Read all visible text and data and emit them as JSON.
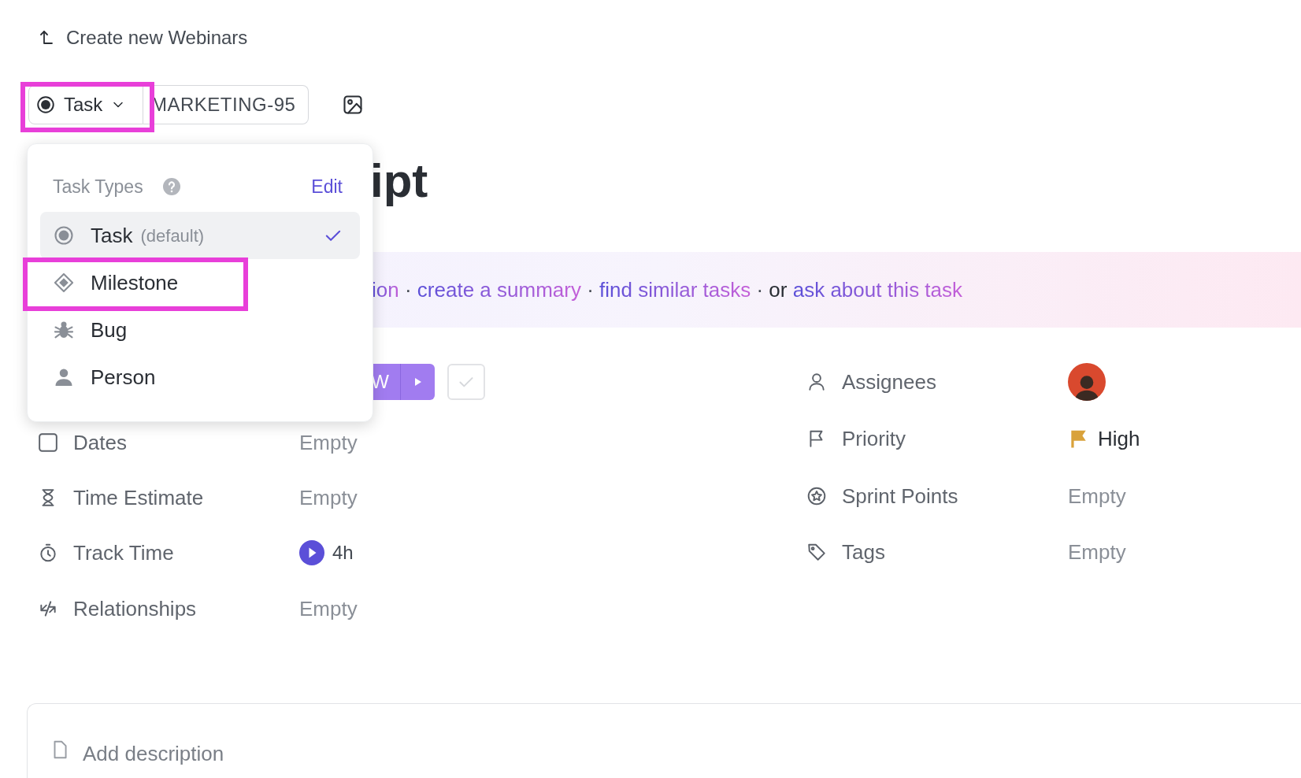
{
  "breadcrumb": {
    "label": "Create new Webinars"
  },
  "task_type_button": {
    "label": "Task",
    "highlighted": true
  },
  "task_id": "MARKETING-95",
  "title": "ipt",
  "task_type_menu": {
    "heading": "Task Types",
    "edit_label": "Edit",
    "items": [
      {
        "kind": "task",
        "label": "Task",
        "note": "(default)",
        "selected": true,
        "highlighted": false
      },
      {
        "kind": "milestone",
        "label": "Milestone",
        "selected": false,
        "highlighted": true
      },
      {
        "kind": "bug",
        "label": "Bug",
        "selected": false,
        "highlighted": false
      },
      {
        "kind": "person",
        "label": "Person",
        "selected": false,
        "highlighted": false
      }
    ]
  },
  "ai_banner": {
    "segments": [
      {
        "kind": "link",
        "text": "ion"
      },
      {
        "kind": "separator",
        "text": "·"
      },
      {
        "kind": "link",
        "text": "create a summary"
      },
      {
        "kind": "separator",
        "text": "·"
      },
      {
        "kind": "link",
        "text": "find similar tasks"
      },
      {
        "kind": "separator",
        "text": "·"
      },
      {
        "kind": "plain",
        "text": "or"
      },
      {
        "kind": "link",
        "text": "ask about this task"
      }
    ]
  },
  "status_button": {
    "label": "W"
  },
  "complete_checkbox": {
    "checked": false
  },
  "fields_left": [
    {
      "kind": "dates",
      "label": "Dates",
      "value": "Empty"
    },
    {
      "kind": "time_estimate",
      "label": "Time Estimate",
      "value": "Empty"
    },
    {
      "kind": "track_time",
      "label": "Track Time",
      "value": "4h"
    },
    {
      "kind": "relationships",
      "label": "Relationships",
      "value": "Empty"
    }
  ],
  "fields_right": [
    {
      "kind": "assignees",
      "label": "Assignees"
    },
    {
      "kind": "priority",
      "label": "Priority",
      "value": "High"
    },
    {
      "kind": "sprint_points",
      "label": "Sprint Points",
      "value": "Empty"
    },
    {
      "kind": "tags",
      "label": "Tags",
      "value": "Empty"
    }
  ],
  "description": {
    "placeholder": "Add description"
  }
}
